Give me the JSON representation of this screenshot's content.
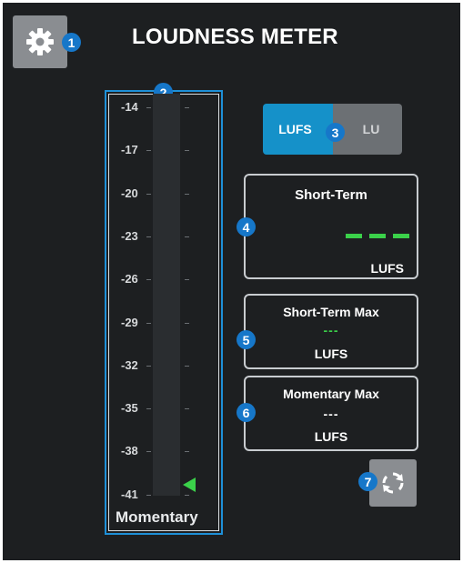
{
  "header": {
    "title": "LOUDNESS METER",
    "settings_icon": "gear-icon"
  },
  "callouts": [
    "1",
    "2",
    "3",
    "4",
    "5",
    "6",
    "7"
  ],
  "meter": {
    "scale": [
      "-14",
      "-17",
      "-20",
      "-23",
      "-26",
      "-29",
      "-32",
      "-35",
      "-38",
      "-41"
    ],
    "label": "Momentary",
    "pointer_icon": "triangle-pointer-icon",
    "level_lufs": -41
  },
  "unit_toggle": {
    "options": [
      "LUFS",
      "LU"
    ],
    "selected": "LUFS"
  },
  "readouts": {
    "short_term": {
      "title": "Short-Term",
      "value": "---",
      "unit": "LUFS"
    },
    "short_term_max": {
      "title": "Short-Term Max",
      "value": "---",
      "unit": "LUFS"
    },
    "momentary_max": {
      "title": "Momentary Max",
      "value": "---",
      "unit": "LUFS"
    }
  },
  "reset_button": {
    "icon": "refresh-icon"
  },
  "colors": {
    "accent": "#1591c9",
    "callout": "#1677c9",
    "meter_green": "#3bd14a",
    "background": "#1d1f21",
    "button_gray": "#8a8d91"
  }
}
